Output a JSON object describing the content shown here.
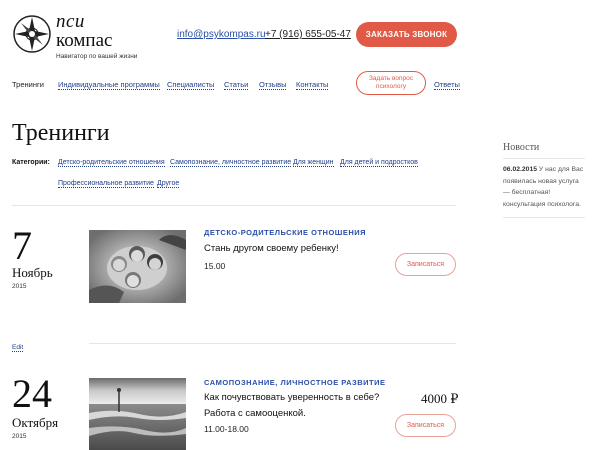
{
  "brand": {
    "name_line1": "пси",
    "name_line2": "компас",
    "tagline": "Навигатор по вашей жизни"
  },
  "contacts": {
    "email": "info@psykompas.ru",
    "phone": "+7 (916) 655-05-47"
  },
  "header": {
    "call_button": "ЗАКАЗАТЬ ЗВОНОК",
    "ask_button": "Задать вопрос психологу"
  },
  "nav": {
    "items": [
      {
        "label": "Тренинги"
      },
      {
        "label": "Индивидуальные программы"
      },
      {
        "label": "Специалисты"
      },
      {
        "label": "Статьи"
      },
      {
        "label": "Отзывы"
      },
      {
        "label": "Контакты"
      },
      {
        "label": "Ответы"
      }
    ]
  },
  "page": {
    "title": "Тренинги",
    "categories_label": "Категории:",
    "categories": [
      {
        "label": "Детско-родительские отношения"
      },
      {
        "label": "Самопознание, личностное развитие"
      },
      {
        "label": "Для женщин"
      },
      {
        "label": "Для детей и подростков"
      },
      {
        "label": "Профессиональное развитие"
      },
      {
        "label": "Другое"
      }
    ]
  },
  "events": [
    {
      "day": "7",
      "month": "Ноябрь",
      "year": "2015",
      "category": "ДЕТСКО-РОДИТЕЛЬСКИЕ ОТНОШЕНИЯ",
      "title": "Стань другом своему ребенку!",
      "time": "15.00",
      "signup": "Записаться",
      "edit": "Edit"
    },
    {
      "day": "24",
      "month": "Октября",
      "year": "2015",
      "category": "САМОПОЗНАНИЕ, ЛИЧНОСТНОЕ РАЗВИТИЕ",
      "title": "Как почувствовать уверенность в себе? Работа с самооценкой.",
      "time": "11.00-18.00",
      "price": "4000 ₽",
      "signup": "Записаться"
    }
  ],
  "sidebar": {
    "news_title": "Новости",
    "news_date": "06.02.2015",
    "news_text": "У нас для Вас появилась новая услуга — бесплатная! консультация психолога."
  },
  "colors": {
    "accent": "#e15a47",
    "link": "#1f3d8c",
    "category": "#2b4fa8"
  }
}
